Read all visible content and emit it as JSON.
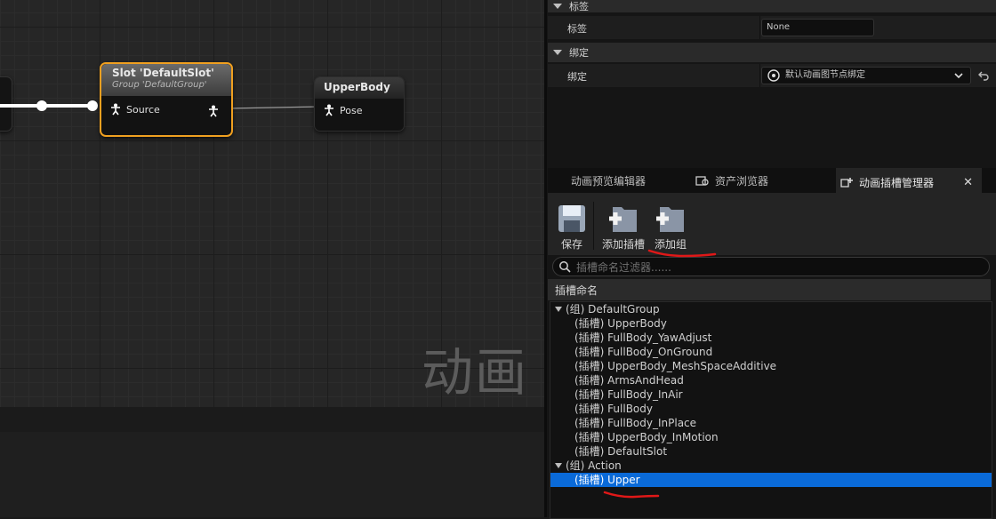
{
  "graph": {
    "watermark": "动画",
    "slot_node": {
      "title": "Slot 'DefaultSlot'",
      "subtitle": "Group 'DefaultGroup'",
      "input_pin": "Source"
    },
    "upperbody_node": {
      "title": "UpperBody",
      "input_pin": "Pose"
    }
  },
  "details": {
    "tag_section": {
      "header": "标签",
      "label": "标签",
      "value": "None"
    },
    "binding_section": {
      "header": "绑定",
      "label": "绑定",
      "value": "默认动画图节点绑定"
    }
  },
  "tabs": [
    {
      "label": "动画预览编辑器",
      "active": false
    },
    {
      "label": "资产浏览器",
      "active": false
    },
    {
      "label": "动画插槽管理器",
      "active": true
    }
  ],
  "toolbar": {
    "save_label": "保存",
    "add_slot_label": "添加插槽",
    "add_group_label": "添加组"
  },
  "search": {
    "placeholder": "插槽命名过滤器......"
  },
  "list": {
    "header": "插槽命名",
    "groups": [
      {
        "label": "(组) DefaultGroup",
        "slots": [
          "(插槽) UpperBody",
          "(插槽) FullBody_YawAdjust",
          "(插槽) FullBody_OnGround",
          "(插槽) UpperBody_MeshSpaceAdditive",
          "(插槽) ArmsAndHead",
          "(插槽) FullBody_InAir",
          "(插槽) FullBody",
          "(插槽) FullBody_InPlace",
          "(插槽) UpperBody_InMotion",
          "(插槽) DefaultSlot"
        ]
      },
      {
        "label": "(组) Action",
        "slots": [
          "(插槽) Upper"
        ]
      }
    ],
    "selected": "(插槽) Upper"
  },
  "colors": {
    "accent": "#f0a020",
    "selection": "#0a6ad8",
    "annotation": "#e01818"
  }
}
